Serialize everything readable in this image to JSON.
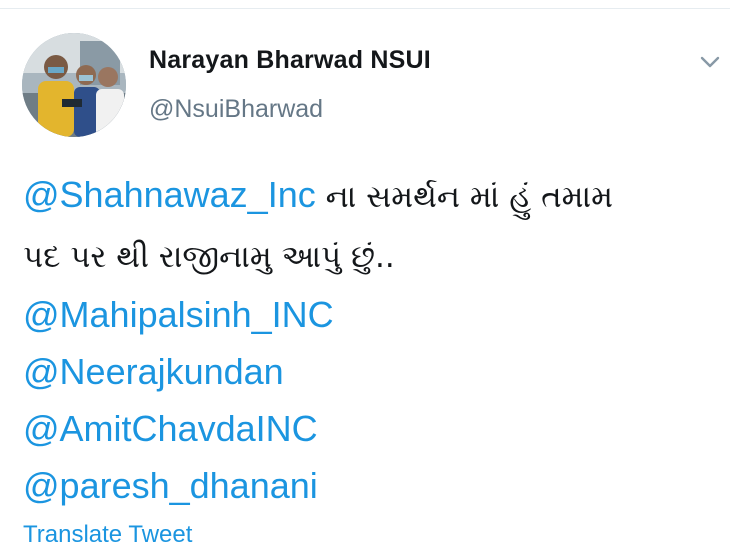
{
  "tweet": {
    "author": {
      "name": "Narayan Bharwad NSUI",
      "handle": "@NsuiBharwad",
      "avatar_icon": "profile-photo"
    },
    "menu_icon": "chevron-down-icon",
    "lines": [
      {
        "mention": "@Shahnawaz_Inc",
        "text": " ના સમર્થન માં હું તમામ"
      },
      {
        "text": "પદ પર થી રાજીનામુ આપું છું.."
      },
      {
        "mention": "@Mahipalsinh_INC"
      },
      {
        "mention": "@Neerajkundan"
      },
      {
        "mention": "@AmitChavdaINC"
      },
      {
        "mention": "@paresh_dhanani"
      }
    ],
    "translate_label": "Translate Tweet"
  },
  "colors": {
    "link": "#1b95e0",
    "text": "#14171a",
    "secondary": "#657786",
    "divider": "#e6ecf0"
  }
}
